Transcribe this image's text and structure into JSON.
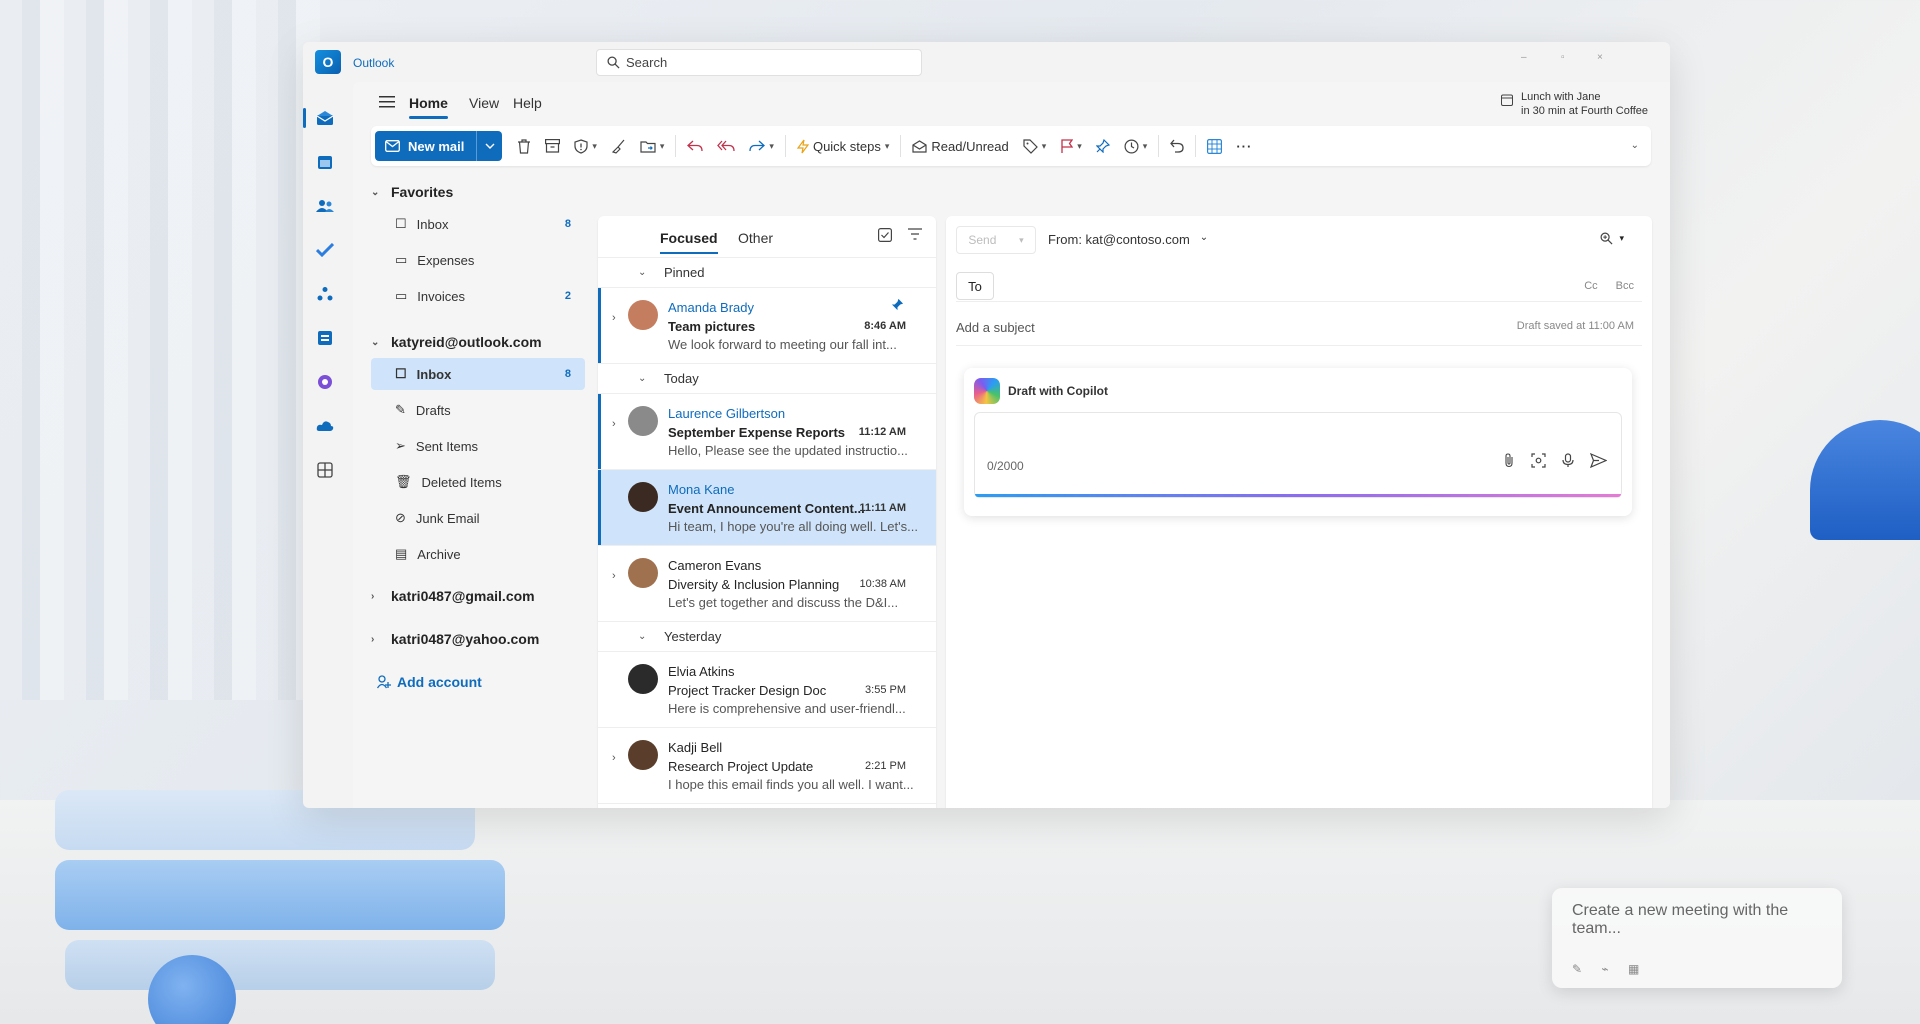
{
  "window": {
    "app_title": "Outlook"
  },
  "search": {
    "placeholder": "Search"
  },
  "window_controls": {
    "minimize": "–",
    "maximize": "▫",
    "close": "×"
  },
  "menu": {
    "tabs": [
      "Home",
      "View",
      "Help"
    ],
    "active": "Home"
  },
  "reminder": {
    "title": "Lunch with Jane",
    "detail": "in 30 min at Fourth Coffee"
  },
  "ribbon": {
    "new_mail": "New mail",
    "quick_steps": "Quick steps",
    "read_unread": "Read/Unread",
    "more": "···"
  },
  "folders": {
    "favorites_label": "Favorites",
    "favorites": [
      {
        "label": "Inbox",
        "count": "8",
        "icon": "inbox-icon"
      },
      {
        "label": "Expenses",
        "count": "",
        "icon": "folder-icon"
      },
      {
        "label": "Invoices",
        "count": "2",
        "icon": "folder-icon"
      }
    ],
    "account1": "katyreid@outlook.com",
    "account1_items": [
      {
        "label": "Inbox",
        "count": "8",
        "icon": "inbox-icon",
        "selected": true
      },
      {
        "label": "Drafts",
        "count": "",
        "icon": "drafts-icon"
      },
      {
        "label": "Sent Items",
        "count": "",
        "icon": "send-icon"
      },
      {
        "label": "Deleted Items",
        "count": "",
        "icon": "trash-icon"
      },
      {
        "label": "Junk Email",
        "count": "",
        "icon": "junk-icon"
      },
      {
        "label": "Archive",
        "count": "",
        "icon": "archive-icon"
      }
    ],
    "account2": "katri0487@gmail.com",
    "account3": "katri0487@yahoo.com",
    "add_account": "Add account"
  },
  "list": {
    "tab_focused": "Focused",
    "tab_other": "Other",
    "groups": {
      "pinned": "Pinned",
      "today": "Today",
      "yesterday": "Yesterday"
    },
    "messages": [
      {
        "sender": "Amanda Brady",
        "subject": "Team pictures",
        "time": "8:46 AM",
        "preview": "We look forward to meeting our fall int...",
        "unread": true,
        "pinned": true,
        "avatar_color": "#c47d5e"
      },
      {
        "sender": "Laurence Gilbertson",
        "subject": "September Expense Reports",
        "time": "11:12 AM",
        "preview": "Hello, Please see the updated instructio...",
        "unread": true,
        "avatar_color": "#8a8a8a"
      },
      {
        "sender": "Mona Kane",
        "subject": "Event Announcement Content...",
        "time": "11:11 AM",
        "preview": "Hi team, I hope you're all doing well. Let's...",
        "unread": true,
        "selected": true,
        "avatar_color": "#3b2a22"
      },
      {
        "sender": "Cameron Evans",
        "subject": "Diversity & Inclusion Planning",
        "time": "10:38 AM",
        "preview": "Let's get together and discuss the D&I...",
        "avatar_color": "#a0714f"
      },
      {
        "sender": "Elvia Atkins",
        "subject": "Project Tracker Design Doc",
        "time": "3:55 PM",
        "preview": "Here is comprehensive and user-friendl...",
        "avatar_color": "#2b2b2b"
      },
      {
        "sender": "Kadji Bell",
        "subject": "Research Project Update",
        "time": "2:21 PM",
        "preview": "I hope this email finds you all well. I want...",
        "avatar_color": "#5a3e2b"
      }
    ]
  },
  "compose": {
    "send": "Send",
    "from": "From: kat@contoso.com",
    "to": "To",
    "cc": "Cc",
    "bcc": "Bcc",
    "subject_placeholder": "Add a subject",
    "draft_saved": "Draft saved at 11:00 AM",
    "copilot_title": "Draft with Copilot",
    "counter": "0/2000"
  },
  "background_card": {
    "text": "Create a new meeting with the team..."
  },
  "colors": {
    "accent": "#0f6cbd",
    "selected": "#cfe4fa"
  }
}
